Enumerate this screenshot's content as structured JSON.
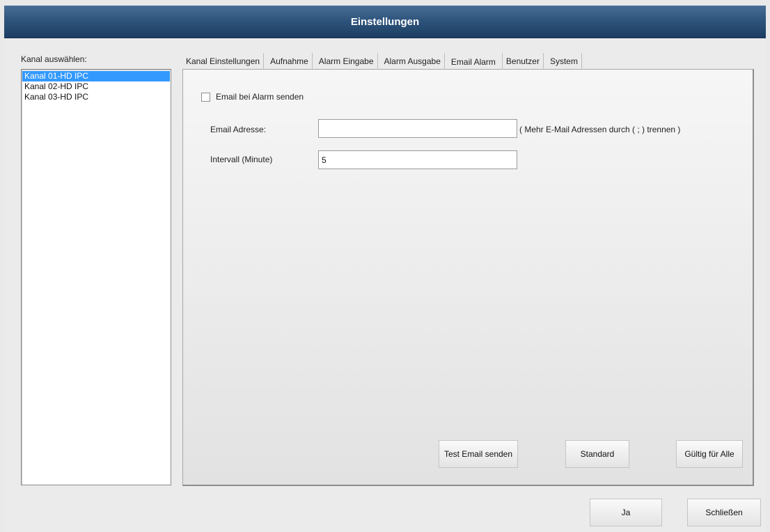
{
  "window": {
    "title": "Einstellungen"
  },
  "channels": {
    "label": "Kanal auswählen:",
    "items": [
      "Kanal 01-HD IPC",
      "Kanal 02-HD IPC",
      "Kanal 03-HD IPC"
    ],
    "selected": "Kanal 01-HD IPC"
  },
  "tabs": [
    "Kanal Einstellungen",
    "Aufnahme",
    "Alarm Eingabe",
    "Alarm Ausgabe",
    "Email Alarm",
    "Benutzer",
    "System"
  ],
  "active_tab": "Email Alarm",
  "email_alarm": {
    "send_checkbox_label": "Email bei Alarm senden",
    "send_checked": false,
    "address_label": "Email Adresse:",
    "address_value": "",
    "address_hint": "( Mehr E-Mail Adressen durch ( ; ) trennen )",
    "interval_label": "Intervall (Minute)",
    "interval_value": "5"
  },
  "buttons": {
    "test_email": "Test Email senden",
    "standard": "Standard",
    "apply_all": "Gültig für Alle",
    "yes": "Ja",
    "close": "Schließen"
  }
}
